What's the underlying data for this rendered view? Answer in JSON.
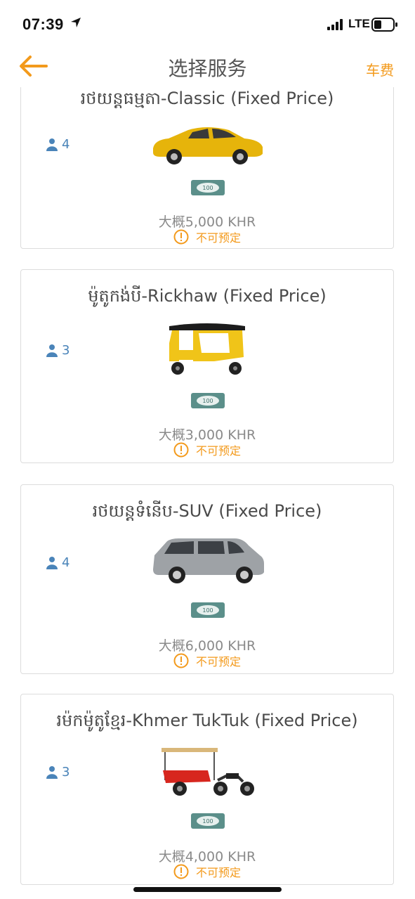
{
  "status": {
    "time": "07:39",
    "network": "LTE"
  },
  "header": {
    "title": "选择服务",
    "fare_label": "车费"
  },
  "colors": {
    "accent": "#f39a1c",
    "capacity": "#4a84b9"
  },
  "services": [
    {
      "title": "រថយន្តធម្មតា-Classic (Fixed Price)",
      "capacity": "4",
      "bill": "100",
      "price": "大概5,000 KHR",
      "note": "不可预定",
      "vehicle_icon": "yellow-car-icon"
    },
    {
      "title": "ម៉ូតូកង់បី-Rickhaw (Fixed Price)",
      "capacity": "3",
      "bill": "100",
      "price": "大概3,000 KHR",
      "note": "不可预定",
      "vehicle_icon": "rickshaw-icon"
    },
    {
      "title": "រថយន្តទំនើប-SUV (Fixed Price)",
      "capacity": "4",
      "bill": "100",
      "price": "大概6,000 KHR",
      "note": "不可预定",
      "vehicle_icon": "suv-icon"
    },
    {
      "title": "រម៉កម៉ូតូខ្មែរ-Khmer TukTuk (Fixed Price)",
      "capacity": "3",
      "bill": "100",
      "price": "大概4,000 KHR",
      "note": "不可预定",
      "vehicle_icon": "tuktuk-icon"
    }
  ]
}
